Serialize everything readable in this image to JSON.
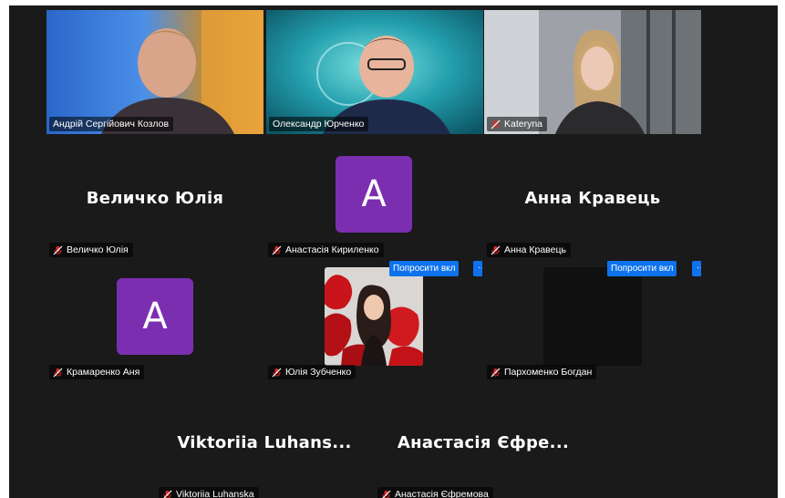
{
  "colors": {
    "active_speaker": "#2fd36b",
    "avatar_bg": "#7b2fb0",
    "button_blue": "#0e72ed",
    "mute_red": "#e02828"
  },
  "tiles": [
    {
      "label": "Андрій Сергійович Козлов",
      "muted": false
    },
    {
      "label": "Олександр Юрченко",
      "muted": false
    },
    {
      "label": "Kateryna",
      "muted": true
    },
    {
      "label": "Величко Юлія",
      "display": "Величко Юлія",
      "muted": true
    },
    {
      "label": "Анастасія Кириленко",
      "avatar": "A",
      "muted": true
    },
    {
      "label": "Анна Кравець",
      "display": "Анна Кравець",
      "muted": true
    },
    {
      "label": "Крамаренко Аня",
      "avatar": "A",
      "muted": true
    },
    {
      "label": "Юлія Зубченко",
      "muted": true
    },
    {
      "label": "Пархоменко Богдан",
      "muted": true
    },
    {
      "label": "Viktoriia Luhanska",
      "display": "Viktoriia  Luhans...",
      "muted": true
    },
    {
      "label": "Анастасія Єфремова",
      "display": "Анастасія Єфре...",
      "muted": true
    }
  ],
  "actions": {
    "ask_unmute": "Попросити вкл",
    "more": "···"
  }
}
